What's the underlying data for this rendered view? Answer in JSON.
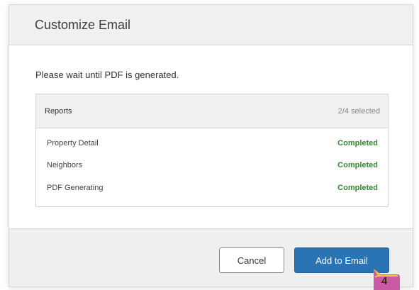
{
  "dialog": {
    "title": "Customize Email",
    "instruction": "Please wait until PDF is generated."
  },
  "reports": {
    "header_label": "Reports",
    "selected_count": "2/4 selected",
    "items": [
      {
        "name": "Property Detail",
        "status": "Completed"
      },
      {
        "name": "Neighbors",
        "status": "Completed"
      },
      {
        "name": "PDF Generating",
        "status": "Completed"
      }
    ]
  },
  "footer": {
    "cancel_label": "Cancel",
    "add_label": "Add to Email"
  },
  "step_badge": "4",
  "colors": {
    "primary_button": "#2a74b5",
    "status_completed": "#2e8b2e",
    "badge_fill": "#c85aa6",
    "badge_accent": "#f0c030"
  }
}
